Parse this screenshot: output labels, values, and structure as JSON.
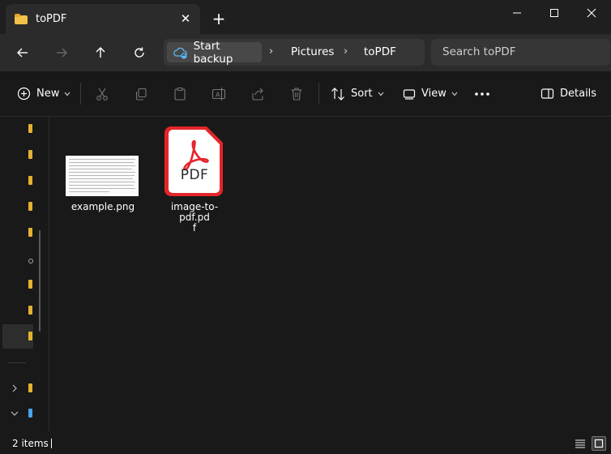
{
  "window": {
    "tab_title": "toPDF"
  },
  "address": {
    "backup_label": "Start backup",
    "crumbs": [
      "Pictures",
      "toPDF"
    ],
    "search_placeholder": "Search toPDF"
  },
  "commands": {
    "new": "New",
    "sort": "Sort",
    "view": "View",
    "details": "Details"
  },
  "files": [
    {
      "name": "example.png",
      "type": "image"
    },
    {
      "name_line1": "image-to-pdf.pd",
      "name_line2": "f",
      "type": "pdf",
      "badge": "PDF"
    }
  ],
  "status": {
    "count": "2 items"
  },
  "colors": {
    "folder": "#f2c14b",
    "pdf_red": "#e5252a",
    "background": "#191919"
  }
}
